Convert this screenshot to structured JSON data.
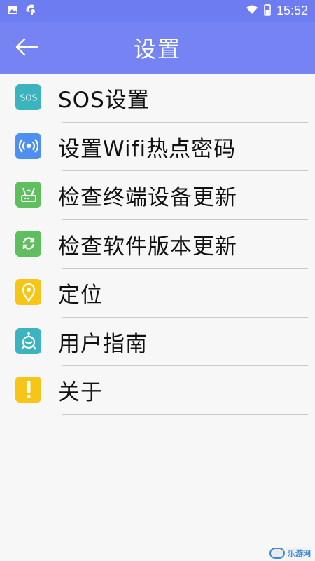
{
  "status_bar": {
    "time": "15:52",
    "icons": [
      "image-icon",
      "satellite-icon",
      "wifi-icon",
      "battery-icon"
    ]
  },
  "app_bar": {
    "title": "设置",
    "back_icon": "back-arrow-icon",
    "background": "#7683f3"
  },
  "menu": {
    "items": [
      {
        "label": "SOS设置",
        "icon": "sos-icon",
        "color": "#3bb4bf"
      },
      {
        "label": "设置Wifi热点密码",
        "icon": "wifi-hotspot-icon",
        "color": "#4f8ff0"
      },
      {
        "label": "检查终端设备更新",
        "icon": "router-icon",
        "color": "#5fbf5f"
      },
      {
        "label": "检查软件版本更新",
        "icon": "refresh-icon",
        "color": "#5fbf5f"
      },
      {
        "label": "定位",
        "icon": "location-pin-icon",
        "color": "#f5c518"
      },
      {
        "label": "用户指南",
        "icon": "guide-robot-icon",
        "color": "#3bb4bf"
      },
      {
        "label": "关于",
        "icon": "info-exclamation-icon",
        "color": "#f5c518"
      }
    ]
  },
  "watermark": {
    "text": "乐游网",
    "icon": "logo-mark-icon"
  }
}
